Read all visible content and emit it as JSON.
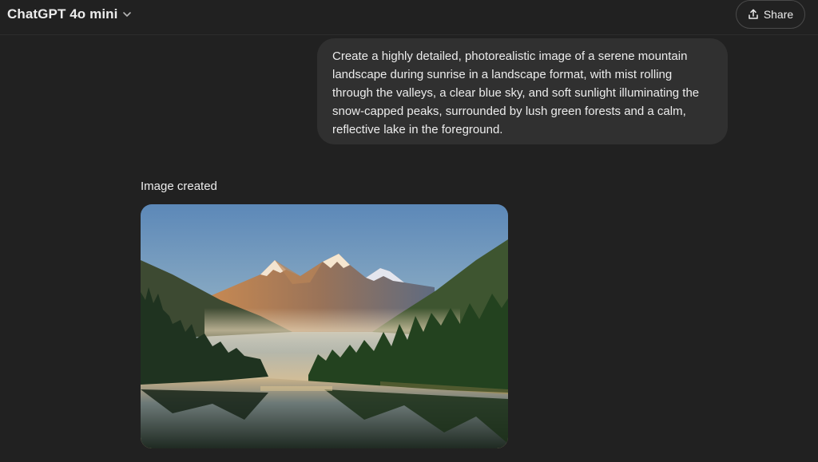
{
  "header": {
    "model_name": "ChatGPT 4o mini",
    "model_chevron_icon": "chevron-down-icon",
    "share_label": "Share",
    "share_icon": "share-upload-icon"
  },
  "conversation": {
    "user_message": "Create a highly detailed, photorealistic image of a serene mountain landscape during sunrise in a landscape format, with mist rolling through the valleys, a clear blue sky, and soft sunlight illuminating the snow-capped peaks, surrounded by lush green forests and a calm, reflective lake in the foreground.",
    "assistant_status": "Image created"
  },
  "colors": {
    "background": "#212121",
    "bubble": "#303030",
    "text": "#ececec",
    "border": "#4a4a4a"
  }
}
